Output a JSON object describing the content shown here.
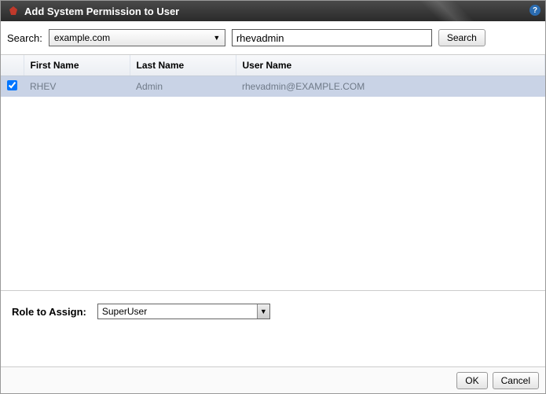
{
  "dialog": {
    "title": "Add System Permission to User"
  },
  "search": {
    "label": "Search:",
    "domain": "example.com",
    "query": "rhevadmin",
    "button": "Search"
  },
  "table": {
    "headers": {
      "first_name": "First Name",
      "last_name": "Last Name",
      "user_name": "User Name"
    },
    "rows": [
      {
        "checked": true,
        "first_name": "RHEV",
        "last_name": "Admin",
        "user_name": "rhevadmin@EXAMPLE.COM"
      }
    ]
  },
  "role": {
    "label": "Role to Assign:",
    "selected": "SuperUser"
  },
  "footer": {
    "ok": "OK",
    "cancel": "Cancel"
  }
}
